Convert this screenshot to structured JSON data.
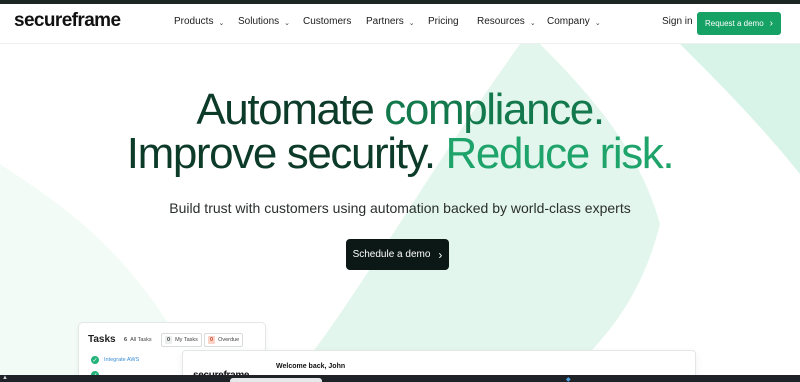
{
  "brand": {
    "logo_text": "secureframe",
    "accent": "#16a265"
  },
  "nav": {
    "items": [
      {
        "label": "Products",
        "dropdown": true
      },
      {
        "label": "Solutions",
        "dropdown": true
      },
      {
        "label": "Customers",
        "dropdown": false
      },
      {
        "label": "Partners",
        "dropdown": true
      },
      {
        "label": "Pricing",
        "dropdown": false
      },
      {
        "label": "Resources",
        "dropdown": true
      },
      {
        "label": "Company",
        "dropdown": true
      }
    ],
    "signin_label": "Sign in",
    "request_demo_label": "Request a demo"
  },
  "hero": {
    "line1_a": "Automate ",
    "line1_b": "compliance.",
    "line2_a": "Improve security. ",
    "line2_b": "Reduce risk.",
    "subtitle": "Build trust with customers using automation backed by world-class experts",
    "cta_label": "Schedule a demo",
    "colors": {
      "dark": "#0d3b2a",
      "mid": "#13794d",
      "bright": "#1ea36a"
    }
  },
  "preview": {
    "tasks_title": "Tasks",
    "tabs": [
      {
        "count": "6",
        "label": "All Tasks"
      },
      {
        "count": "0",
        "label": "My Tasks"
      },
      {
        "count": "0",
        "label": "Overdue"
      }
    ],
    "task_item": "Integrate AWS",
    "dashboard_logo": "secureframe",
    "welcome": "Welcome back, John"
  },
  "icons": {
    "chevron": "chevron-down-icon",
    "arrow": "chevron-right-icon",
    "check": "check-circle-icon"
  }
}
